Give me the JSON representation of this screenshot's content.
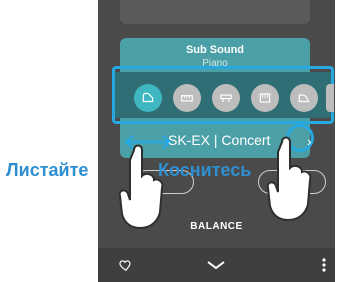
{
  "app": {
    "subsound_title": "Sub Sound",
    "subsound_subtitle": "Piano",
    "sound_name": "SK-EX | Concert",
    "balance_label": "BALANCE"
  },
  "labels": {
    "scroll": "Листайте",
    "tap": "Коснитесь"
  },
  "icons": [
    "grand-piano-icon",
    "upright-keys-icon",
    "electric-piano-icon",
    "organ-icon",
    "harpsichord-icon",
    "partial-icon"
  ],
  "colors": {
    "teal": "#4aa0a6",
    "accent_blue": "#27a8df",
    "label_blue": "#2f8fd1"
  }
}
